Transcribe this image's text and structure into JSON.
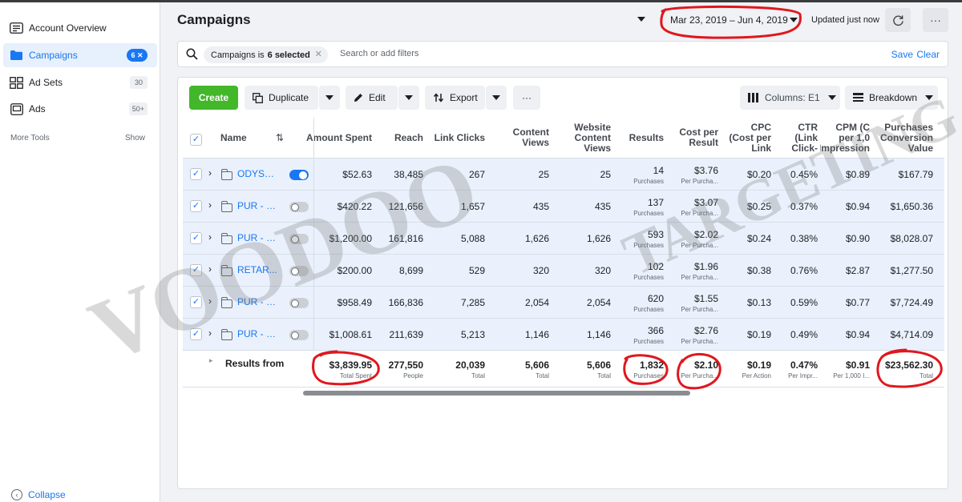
{
  "sidebar": {
    "items": [
      {
        "label": "Account Overview",
        "icon": "overview-icon",
        "badge": ""
      },
      {
        "label": "Campaigns",
        "icon": "folder-icon",
        "badge": "6 ✕"
      },
      {
        "label": "Ad Sets",
        "icon": "grid-icon",
        "badge": "30"
      },
      {
        "label": "Ads",
        "icon": "ad-icon",
        "badge": "50+"
      }
    ],
    "more_tools": "More Tools",
    "show": "Show",
    "collapse": "Collapse"
  },
  "header": {
    "title": "Campaigns",
    "date_range": "Mar 23, 2019 – Jun 4, 2019",
    "updated": "Updated just now",
    "more": "···"
  },
  "search": {
    "chip_label": "Campaigns is",
    "chip_value": "6 selected",
    "chip_close": "✕",
    "placeholder": "Search or add filters",
    "save": "Save",
    "clear": "Clear"
  },
  "toolbar": {
    "create": "Create",
    "duplicate": "Duplicate",
    "edit": "Edit",
    "export": "Export",
    "more": "···",
    "columns": "Columns: E1",
    "breakdown": "Breakdown"
  },
  "table": {
    "headers": {
      "name": "Name",
      "amount_spent": "Amount Spent",
      "reach": "Reach",
      "link_clicks": "Link Clicks",
      "content_views": "Content\nViews",
      "website_content_views": "Website\nContent\nViews",
      "results": "Results",
      "cost_per_result": "Cost per\nResult",
      "cpc": "CPC\n(Cost per\nLink",
      "ctr": "CTR\n(Link\nClick-",
      "cpm": "CPM (C\nper 1,0\nImpression",
      "purchases_conversion_value": "Purchases\nConversion\nValue"
    },
    "rows": [
      {
        "name": "ODYSS...",
        "on": true,
        "amount_spent": "$52.63",
        "reach": "38,485",
        "link_clicks": "267",
        "content_views": "25",
        "website_content_views": "25",
        "results": "14",
        "results_sub": "Purchases",
        "cost_per_result": "$3.76",
        "cost_sub": "Per Purcha...",
        "cpc": "$0.20",
        "ctr": "0.45%",
        "cpm": "$0.89",
        "pcv": "$167.79"
      },
      {
        "name": "PUR - M...",
        "on": false,
        "amount_spent": "$420.22",
        "reach": "121,656",
        "link_clicks": "1,657",
        "content_views": "435",
        "website_content_views": "435",
        "results": "137",
        "results_sub": "Purchases",
        "cost_per_result": "$3.07",
        "cost_sub": "Per Purcha...",
        "cpc": "$0.25",
        "ctr": "0.37%",
        "cpm": "$0.94",
        "pcv": "$1,650.36"
      },
      {
        "name": "PUR - M...",
        "on": false,
        "amount_spent": "$1,200.00",
        "reach": "161,816",
        "link_clicks": "5,088",
        "content_views": "1,626",
        "website_content_views": "1,626",
        "results": "593",
        "results_sub": "Purchases",
        "cost_per_result": "$2.02",
        "cost_sub": "Per Purcha...",
        "cpc": "$0.24",
        "ctr": "0.38%",
        "cpm": "$0.90",
        "pcv": "$8,028.07"
      },
      {
        "name": "RETAR...",
        "on": false,
        "amount_spent": "$200.00",
        "reach": "8,699",
        "link_clicks": "529",
        "content_views": "320",
        "website_content_views": "320",
        "results": "102",
        "results_sub": "Purchases",
        "cost_per_result": "$1.96",
        "cost_sub": "Per Purcha...",
        "cpc": "$0.38",
        "ctr": "0.76%",
        "cpm": "$2.87",
        "pcv": "$1,277.50"
      },
      {
        "name": "PUR - M...",
        "on": false,
        "amount_spent": "$958.49",
        "reach": "166,836",
        "link_clicks": "7,285",
        "content_views": "2,054",
        "website_content_views": "2,054",
        "results": "620",
        "results_sub": "Purchases",
        "cost_per_result": "$1.55",
        "cost_sub": "Per Purcha...",
        "cpc": "$0.13",
        "ctr": "0.59%",
        "cpm": "$0.77",
        "pcv": "$7,724.49"
      },
      {
        "name": "PUR - M...",
        "on": false,
        "amount_spent": "$1,008.61",
        "reach": "211,639",
        "link_clicks": "5,213",
        "content_views": "1,146",
        "website_content_views": "1,146",
        "results": "366",
        "results_sub": "Purchases",
        "cost_per_result": "$2.76",
        "cost_sub": "Per Purcha...",
        "cpc": "$0.19",
        "ctr": "0.49%",
        "cpm": "$0.94",
        "pcv": "$4,714.09"
      }
    ],
    "totals": {
      "label": "Results from",
      "amount_spent": "$3,839.95",
      "amount_spent_sub": "Total Spent",
      "reach": "277,550",
      "reach_sub": "People",
      "link_clicks": "20,039",
      "link_clicks_sub": "Total",
      "content_views": "5,606",
      "content_views_sub": "Total",
      "website_content_views": "5,606",
      "website_content_views_sub": "Total",
      "results": "1,832",
      "results_sub": "Purchases",
      "cost_per_result": "$2.10",
      "cost_sub": "Per Purcha...",
      "cpc": "$0.19",
      "cpc_sub": "Per Action",
      "ctr": "0.47%",
      "ctr_sub": "Per Impr...",
      "cpm": "$0.91",
      "cpm_sub": "Per 1,000 I...",
      "pcv": "$23,562.30",
      "pcv_sub": "Total"
    }
  },
  "watermarks": {
    "left": "VOODOO",
    "right": "TARGETING"
  },
  "colors": {
    "accent": "#1877f2",
    "create": "#42b72a",
    "annotation": "#e0171d",
    "row_selected": "#eaf1fc"
  }
}
